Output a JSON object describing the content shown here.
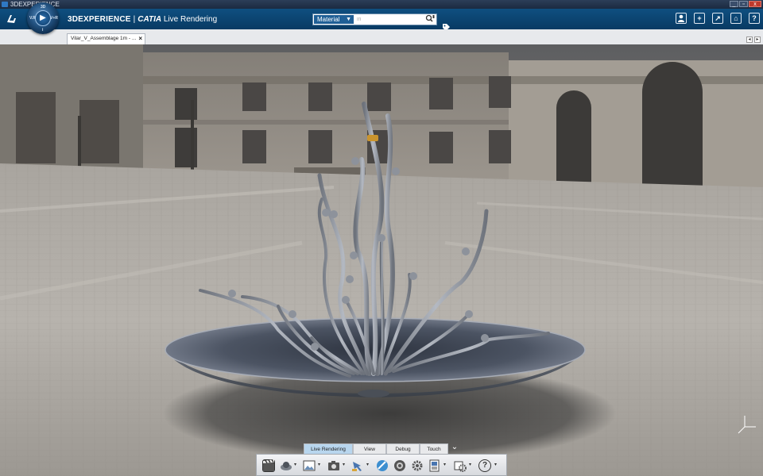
{
  "window": {
    "title": "3DEXPERIENCE",
    "controls": [
      "_",
      "▫",
      "x"
    ]
  },
  "header": {
    "brand": "3DEXPERIENCE",
    "separator": "|",
    "product": "CATIA",
    "app": "Live Rendering",
    "compass_labels": {
      "top": "3D",
      "left": "V.R",
      "right": "V+R",
      "bottom": "i"
    }
  },
  "search": {
    "category": "Material",
    "placeholder": "in"
  },
  "header_buttons": [
    {
      "name": "user-icon",
      "glyph": "👤"
    },
    {
      "name": "add-icon",
      "glyph": "+"
    },
    {
      "name": "share-icon",
      "glyph": "↗"
    },
    {
      "name": "home-icon",
      "glyph": "⌂"
    },
    {
      "name": "help-icon",
      "glyph": "?"
    }
  ],
  "document_tab": {
    "label": "Vilar_V_Assemblage 1m - ...",
    "close": "×"
  },
  "action_tabs": [
    {
      "label": "Live Rendering",
      "active": true
    },
    {
      "label": "View",
      "active": false
    },
    {
      "label": "Debug",
      "active": false
    },
    {
      "label": "Touch",
      "active": false
    }
  ],
  "toolbar_tools": [
    {
      "name": "clapper-icon",
      "caret": false
    },
    {
      "name": "environment-icon",
      "caret": true
    },
    {
      "name": "image-icon",
      "caret": true
    },
    {
      "name": "camera-icon",
      "caret": true
    },
    {
      "name": "light-icon",
      "caret": true
    },
    {
      "name": "material-sphere-icon",
      "caret": false
    },
    {
      "name": "sticker-icon",
      "caret": false
    },
    {
      "name": "settings-gear-icon",
      "caret": false
    },
    {
      "name": "render-settings-icon",
      "caret": true
    },
    {
      "name": "output-icon",
      "caret": true
    },
    {
      "name": "help-icon",
      "caret": true
    }
  ],
  "colors": {
    "header": "#0b446f",
    "tab_active": "#b8d6ee",
    "bowl": "#5c6473",
    "branch": "#9aa0aa"
  }
}
